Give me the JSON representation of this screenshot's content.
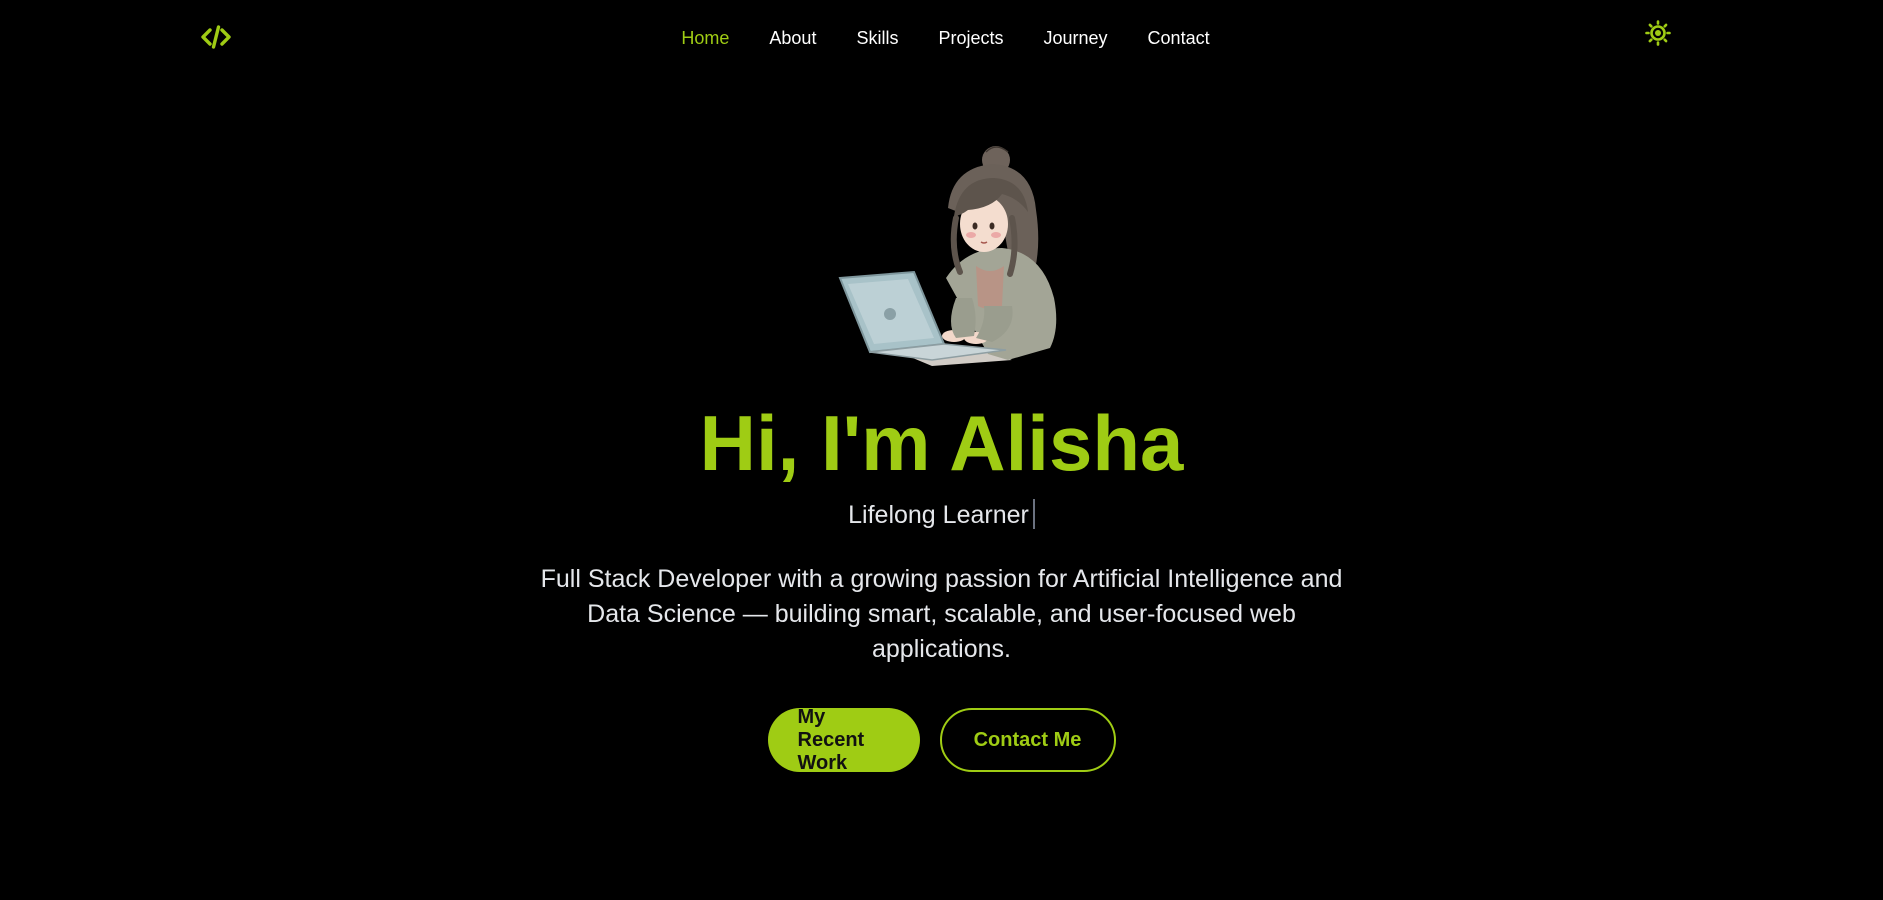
{
  "header": {
    "logo_icon": "code-brackets-icon",
    "nav": [
      {
        "label": "Home",
        "active": true
      },
      {
        "label": "About",
        "active": false
      },
      {
        "label": "Skills",
        "active": false
      },
      {
        "label": "Projects",
        "active": false
      },
      {
        "label": "Journey",
        "active": false
      },
      {
        "label": "Contact",
        "active": false
      }
    ],
    "theme_icon": "sun-icon"
  },
  "hero": {
    "avatar_icon": "girl-with-laptop-illustration",
    "title": "Hi, I'm Alisha",
    "subtitle": "Lifelong Learner",
    "description": "Full Stack Developer with a growing passion for Artificial Intelligence and Data Science — building smart, scalable, and user-focused web applications.",
    "primary_button": "My Recent Work",
    "secondary_button": "Contact Me"
  },
  "colors": {
    "accent": "#9fcc14",
    "background": "#000000",
    "text": "#ffffff"
  }
}
